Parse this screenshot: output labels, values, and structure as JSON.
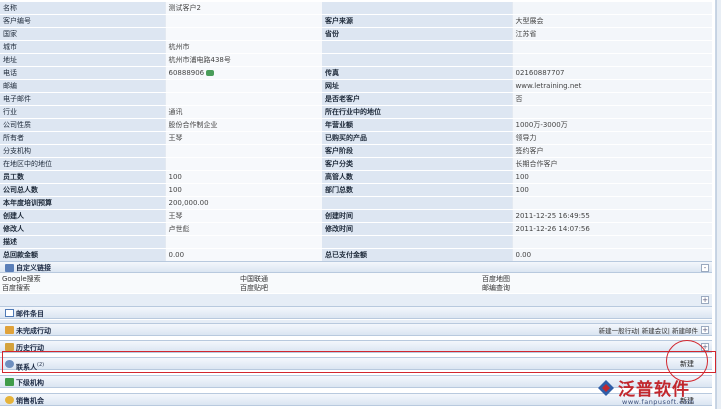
{
  "detail_rows": [
    {
      "l1": "名称",
      "v1": "测试客户2",
      "l2": "",
      "v2": ""
    },
    {
      "l1": "客户编号",
      "v1": "",
      "l2": "客户来源",
      "v2": "大型展会"
    },
    {
      "l1": "国家",
      "v1": "",
      "l2": "省份",
      "v2": "江苏省"
    },
    {
      "l1": "城市",
      "v1": "杭州市",
      "l2": "",
      "v2": ""
    },
    {
      "l1": "地址",
      "v1": "杭州市浦电路438号",
      "l2": "",
      "v2": ""
    },
    {
      "l1": "电话",
      "v1": "60888906",
      "l2": "传真",
      "v2": "02160887707",
      "phone_icon": "phone-icon"
    },
    {
      "l1": "邮编",
      "v1": "",
      "l2": "网址",
      "v2": "www.letraining.net"
    },
    {
      "l1": "电子邮件",
      "v1": "",
      "l2": "是否老客户",
      "v2": "否"
    },
    {
      "l1": "行业",
      "v1": "通讯",
      "l2": "所在行业中的地位",
      "v2": ""
    },
    {
      "l1": "公司性质",
      "v1": "股份合作制企业",
      "l2": "年营业额",
      "v2": "1000万-3000万"
    },
    {
      "l1": "所有者",
      "v1": "王琴",
      "l2": "已购买的产品",
      "v2": "领导力"
    },
    {
      "l1": "分支机构",
      "v1": "",
      "l2": "客户阶段",
      "v2": "签约客户"
    },
    {
      "l1": "在地区中的地位",
      "v1": "",
      "l2": "客户分类",
      "v2": "长期合作客户"
    },
    {
      "l1": "员工数",
      "v1": "100",
      "l2": "高管人数",
      "v2": "100"
    },
    {
      "l1": "公司总人数",
      "v1": "100",
      "l2": "部门总数",
      "v2": "100"
    },
    {
      "l1": "本年度培训预算",
      "v1": "200,000.00",
      "l2": "",
      "v2": ""
    },
    {
      "l1": "创建人",
      "v1": "王琴",
      "l2": "创建时间",
      "v2": "2011-12-25 16:49:55"
    },
    {
      "l1": "修改人",
      "v1": "卢世彪",
      "l2": "修改时间",
      "v2": "2011-12-26 14:07:56"
    },
    {
      "l1": "描述",
      "v1": "",
      "l2": "",
      "v2": ""
    },
    {
      "l1": "总回款金额",
      "v1": "0.00",
      "l2": "总已支付金额",
      "v2": "0.00"
    }
  ],
  "custom_links": {
    "title": "自定义链接",
    "row1": [
      "Google搜索",
      "中国联通",
      "百度地图"
    ],
    "row2": [
      "百度搜索",
      "百度贴吧",
      "邮编查询"
    ]
  },
  "sections": {
    "mail": "邮件条目",
    "open_activities": "未完成行动",
    "open_actions": [
      "新建一般行动",
      "新建会议",
      "新建邮件"
    ],
    "history": "历史行动",
    "contacts": "联系人",
    "contacts_count": "(2)",
    "subsidiaries": "下级机构",
    "opportunities": "销售机会",
    "new_label": "新建"
  },
  "toggles": {
    "expand": "+",
    "collapse": "-"
  },
  "watermark": {
    "brand": "泛普软件",
    "url": "www.fanpusoft.com"
  },
  "colors": {
    "label_bg": "#dde6f2",
    "highlight": "#d2262e",
    "brand_red": "#c2272d"
  }
}
